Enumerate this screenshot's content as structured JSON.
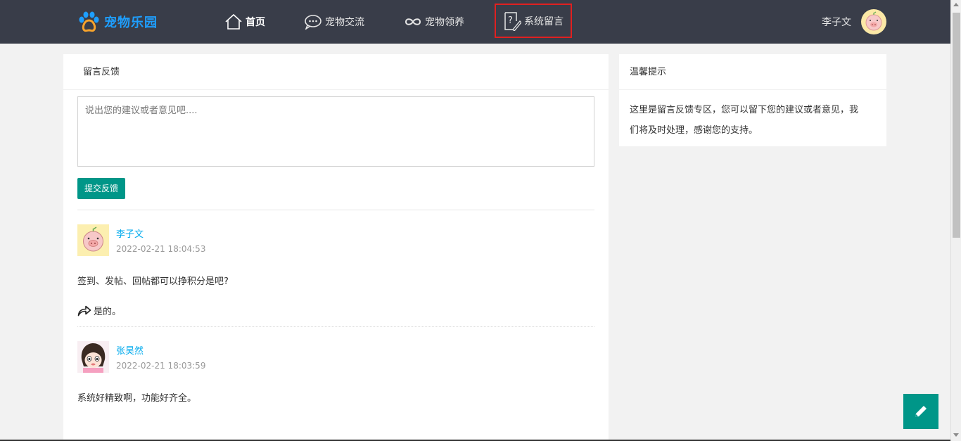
{
  "navbar": {
    "logo_text": "宠物乐园",
    "items": [
      {
        "label": "首页",
        "icon": "home-icon"
      },
      {
        "label": "宠物交流",
        "icon": "chat-icon"
      },
      {
        "label": "宠物领养",
        "icon": "infinity-icon"
      },
      {
        "label": "系统留言",
        "icon": "question-edit-icon"
      }
    ],
    "user_name": "李子文"
  },
  "feedback": {
    "title": "留言反馈",
    "placeholder": "说出您的建议或者意见吧....",
    "submit_label": "提交反馈"
  },
  "comments": [
    {
      "user": "李子文",
      "time": "2022-02-21 18:04:53",
      "text": "签到、发帖、回帖都可以挣积分是吧?",
      "reply": "是的。"
    },
    {
      "user": "张昊然",
      "time": "2022-02-21 18:03:59",
      "text": "系统好精致啊，功能好齐全。"
    }
  ],
  "tips": {
    "title": "温馨提示",
    "line1": "这里是留言反馈专区，您可以留下您的建议或者意见，我",
    "line2": "们将及时处理，感谢您的支持。"
  },
  "colors": {
    "navbar_bg": "#393d49",
    "accent": "#009688",
    "link": "#01aaed",
    "active_outline": "#e02020"
  }
}
